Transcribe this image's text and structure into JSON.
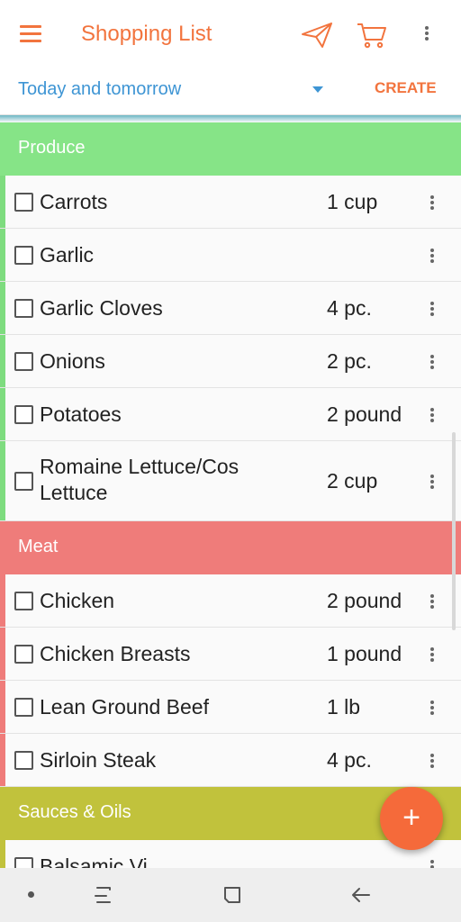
{
  "app_bar": {
    "title": "Shopping List",
    "icons": [
      "menu-icon",
      "send-icon",
      "cart-icon",
      "more-vert-icon"
    ]
  },
  "filter": {
    "selected": "Today and tomorrow",
    "create_label": "CREATE"
  },
  "categories": [
    {
      "name": "Produce",
      "color": "#86e487",
      "stripe": "#7edc7f",
      "items": [
        {
          "name": "Carrots",
          "qty": "1 cup",
          "checked": false
        },
        {
          "name": "Garlic",
          "qty": "",
          "checked": false
        },
        {
          "name": "Garlic Cloves",
          "qty": "4 pc.",
          "checked": false
        },
        {
          "name": "Onions",
          "qty": "2 pc.",
          "checked": false
        },
        {
          "name": "Potatoes",
          "qty": "2 pound",
          "checked": false
        },
        {
          "name": "Romaine Lettuce/Cos Lettuce",
          "qty": "2 cup",
          "checked": false
        }
      ]
    },
    {
      "name": "Meat",
      "color": "#ef7c7a",
      "stripe": "#ef7c7a",
      "items": [
        {
          "name": "Chicken",
          "qty": "2 pound",
          "checked": false
        },
        {
          "name": "Chicken Breasts",
          "qty": "1 pound",
          "checked": false
        },
        {
          "name": "Lean Ground Beef",
          "qty": "1 lb",
          "checked": false
        },
        {
          "name": "Sirloin Steak",
          "qty": "4 pc.",
          "checked": false
        }
      ]
    },
    {
      "name": "Sauces & Oils",
      "color": "#c1c23c",
      "stripe": "#c1c23c",
      "items": [
        {
          "name": "Balsamic Vi",
          "qty": "",
          "checked": false
        }
      ]
    }
  ],
  "fab": {
    "label": "+"
  },
  "colors": {
    "accent": "#f2743e",
    "link": "#3e95d4"
  }
}
